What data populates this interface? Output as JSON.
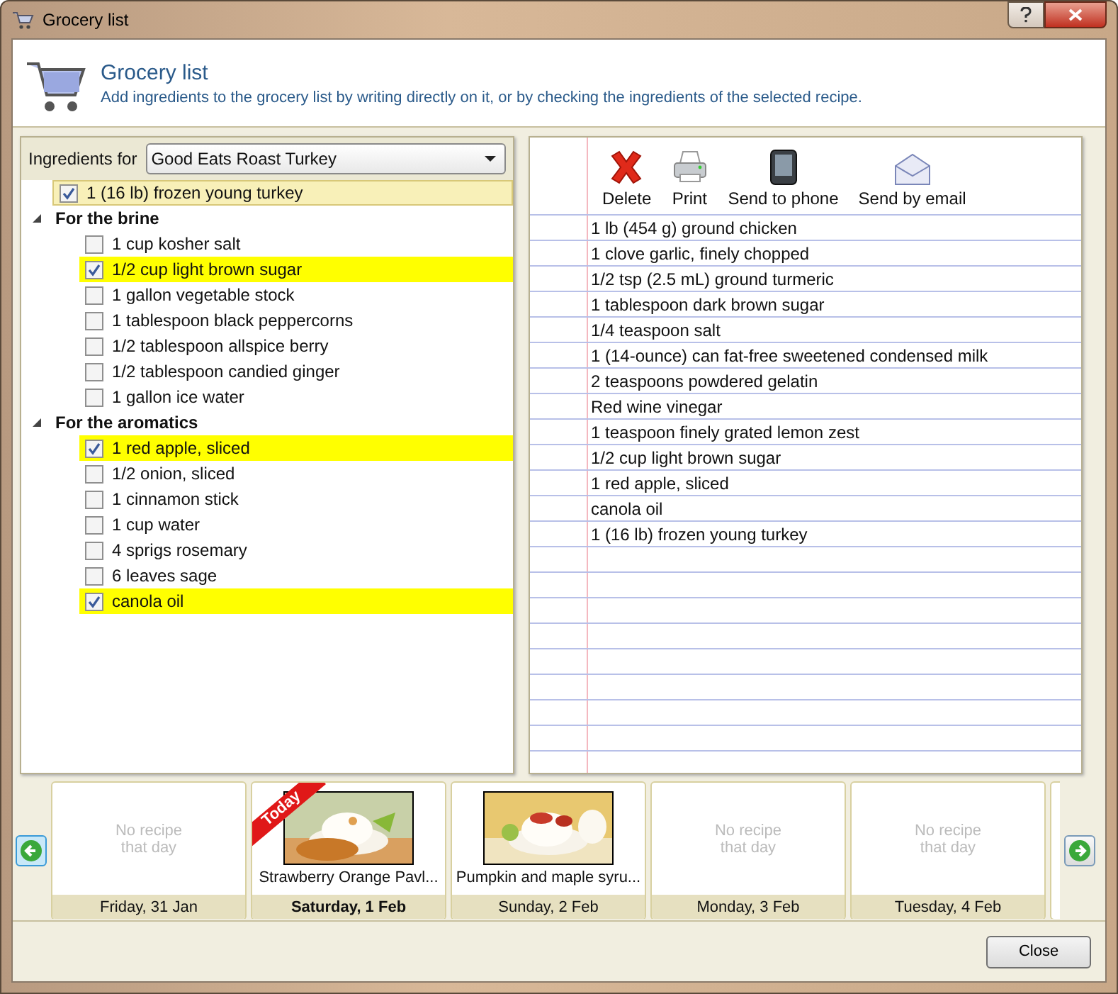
{
  "window": {
    "title": "Grocery list"
  },
  "header": {
    "title": "Grocery list",
    "description": "Add ingredients to the grocery list by writing directly on it, or by checking the ingredients of the selected recipe."
  },
  "ingredients": {
    "label": "Ingredients for",
    "recipe": "Good Eats Roast Turkey",
    "items": [
      {
        "kind": "item",
        "label": "1 (16 lb) frozen young turkey",
        "checked": true,
        "focused": true
      },
      {
        "kind": "group",
        "label": "For the brine",
        "expanded": true,
        "children": [
          {
            "label": "1 cup kosher salt",
            "checked": false
          },
          {
            "label": "1/2 cup light brown sugar",
            "checked": true
          },
          {
            "label": "1 gallon vegetable stock",
            "checked": false
          },
          {
            "label": "1 tablespoon black peppercorns",
            "checked": false
          },
          {
            "label": "1/2 tablespoon allspice berry",
            "checked": false
          },
          {
            "label": "1/2 tablespoon candied ginger",
            "checked": false
          },
          {
            "label": "1 gallon ice water",
            "checked": false
          }
        ]
      },
      {
        "kind": "group",
        "label": "For the aromatics",
        "expanded": true,
        "children": [
          {
            "label": "1 red apple, sliced",
            "checked": true
          },
          {
            "label": "1/2 onion, sliced",
            "checked": false
          },
          {
            "label": "1 cinnamon stick",
            "checked": false
          },
          {
            "label": "1 cup water",
            "checked": false
          },
          {
            "label": "4 sprigs rosemary",
            "checked": false
          },
          {
            "label": "6 leaves sage",
            "checked": false
          },
          {
            "label": "canola oil",
            "checked": true
          }
        ]
      }
    ]
  },
  "toolbar": [
    {
      "kind": "delete",
      "label": "Delete"
    },
    {
      "kind": "print",
      "label": "Print"
    },
    {
      "kind": "phone",
      "label": "Send to phone"
    },
    {
      "kind": "email",
      "label": "Send by email"
    }
  ],
  "grocery_list": [
    "1 lb (454 g) ground chicken",
    "1 clove garlic, finely chopped",
    "1/2 tsp (2.5 mL) ground turmeric",
    "1 tablespoon dark brown sugar",
    "1/4 teaspoon salt",
    "1 (14-ounce) can fat-free sweetened condensed milk",
    "2 teaspoons powdered gelatin",
    "Red wine vinegar",
    "1 teaspoon finely grated lemon zest",
    "1/2 cup light brown sugar",
    "1 red apple, sliced",
    "canola oil",
    "1 (16 lb) frozen young turkey"
  ],
  "days": [
    {
      "kind": "empty",
      "note": "No recipe that day",
      "date": "Friday, 31 Jan",
      "today": false
    },
    {
      "kind": "recipe",
      "recipe": "Strawberry Orange Pavl...",
      "date": "Saturday, 1 Feb",
      "today": true,
      "badge": "Today"
    },
    {
      "kind": "recipe",
      "recipe": "Pumpkin and maple syru...",
      "date": "Sunday, 2 Feb",
      "today": false
    },
    {
      "kind": "empty",
      "note": "No recipe that day",
      "date": "Monday, 3 Feb",
      "today": false
    },
    {
      "kind": "empty",
      "note": "No recipe that day",
      "date": "Tuesday, 4 Feb",
      "today": false
    },
    {
      "kind": "stub"
    }
  ],
  "buttons": [
    "Close"
  ]
}
